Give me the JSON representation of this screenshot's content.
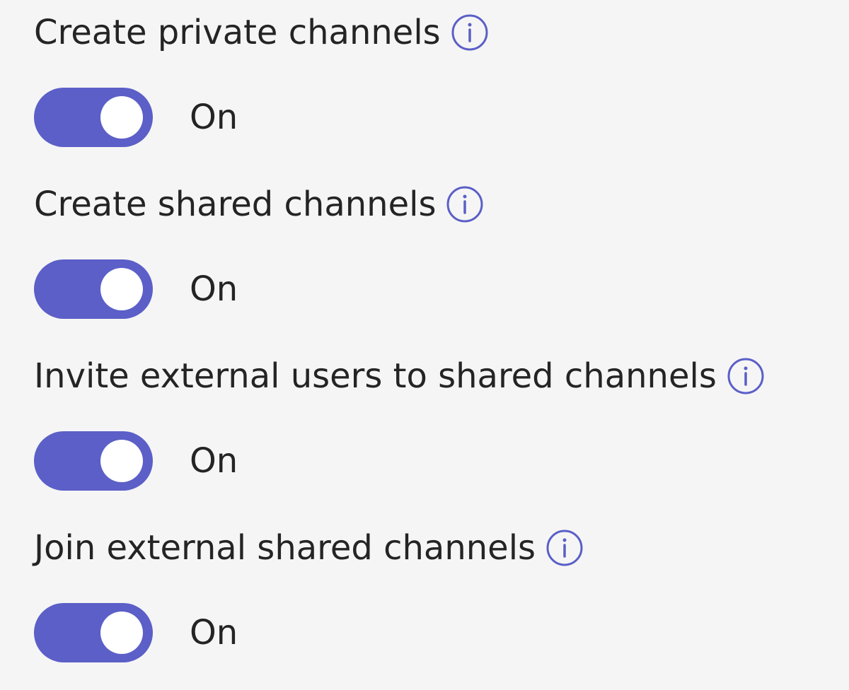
{
  "colors": {
    "background": "#f5f5f5",
    "toggle_on": "#5b5fc7",
    "info_icon": "#5b5fc7",
    "text": "#242424"
  },
  "settings": [
    {
      "label": "Create private channels",
      "info_icon": "info-icon",
      "toggle_on": true,
      "state": "On"
    },
    {
      "label": "Create shared channels",
      "info_icon": "info-icon",
      "toggle_on": true,
      "state": "On"
    },
    {
      "label": "Invite external users to shared channels",
      "info_icon": "info-icon",
      "toggle_on": true,
      "state": "On"
    },
    {
      "label": "Join external shared channels",
      "info_icon": "info-icon",
      "toggle_on": true,
      "state": "On"
    }
  ]
}
